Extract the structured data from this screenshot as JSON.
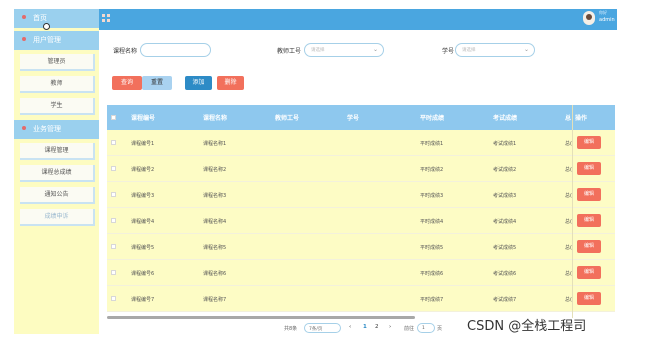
{
  "sidebar": {
    "home": "首页",
    "user_mgmt": "用户管理",
    "user_items": [
      "管理员",
      "教师",
      "学生"
    ],
    "biz_mgmt": "业务管理",
    "biz_items": [
      "课程管理",
      "课程总成绩",
      "通知公告",
      "成绩申诉"
    ]
  },
  "header": {
    "user_line1": "你好",
    "user_name": "admin"
  },
  "search": {
    "course_name_label": "课程名称",
    "course_name_value": "",
    "teacher_id_label": "教师工号",
    "teacher_id_placeholder": "请选择",
    "student_id_label": "学号",
    "student_id_placeholder": "请选择"
  },
  "actions": {
    "query": "查询",
    "reset": "重置",
    "add": "添加",
    "delete": "删除"
  },
  "table": {
    "headers": [
      "课程编号",
      "课程名称",
      "教师工号",
      "学号",
      "平时成绩",
      "考试成绩",
      "总",
      "操作"
    ],
    "rows": [
      {
        "code": "课程编号1",
        "name": "课程名称1",
        "teacher": "",
        "student": "",
        "regular": "平时成绩1",
        "exam": "考试成绩1",
        "total": "总(",
        "op": "编辑"
      },
      {
        "code": "课程编号2",
        "name": "课程名称2",
        "teacher": "",
        "student": "",
        "regular": "平时成绩2",
        "exam": "考试成绩2",
        "total": "总(",
        "op": "编辑"
      },
      {
        "code": "课程编号3",
        "name": "课程名称3",
        "teacher": "",
        "student": "",
        "regular": "平时成绩3",
        "exam": "考试成绩3",
        "total": "总(",
        "op": "编辑"
      },
      {
        "code": "课程编号4",
        "name": "课程名称4",
        "teacher": "",
        "student": "",
        "regular": "平时成绩4",
        "exam": "考试成绩4",
        "total": "总(",
        "op": "编辑"
      },
      {
        "code": "课程编号5",
        "name": "课程名称5",
        "teacher": "",
        "student": "",
        "regular": "平时成绩5",
        "exam": "考试成绩5",
        "total": "总(",
        "op": "编辑"
      },
      {
        "code": "课程编号6",
        "name": "课程名称6",
        "teacher": "",
        "student": "",
        "regular": "平时成绩6",
        "exam": "考试成绩6",
        "total": "总(",
        "op": "编辑"
      },
      {
        "code": "课程编号7",
        "name": "课程名称7",
        "teacher": "",
        "student": "",
        "regular": "平时成绩7",
        "exam": "考试成绩7",
        "total": "总(",
        "op": "编辑"
      }
    ]
  },
  "pagination": {
    "total": "共8条",
    "page_size": "7条/页",
    "prev": "‹",
    "pages": [
      "1",
      "2"
    ],
    "next": "›",
    "goto_label": "前往",
    "goto_value": "1",
    "page_unit": "页"
  },
  "watermark": "CSDN @全栈工程司",
  "colors": {
    "sidebar_bg": "#fdfcc1",
    "nav_bg": "#9ad0ee",
    "topbar_bg": "#4aa6e0",
    "table_head": "#8ec8ee",
    "row_bg": "#fdfcc5",
    "danger": "#f2705c",
    "primary": "#2d8bc6"
  }
}
